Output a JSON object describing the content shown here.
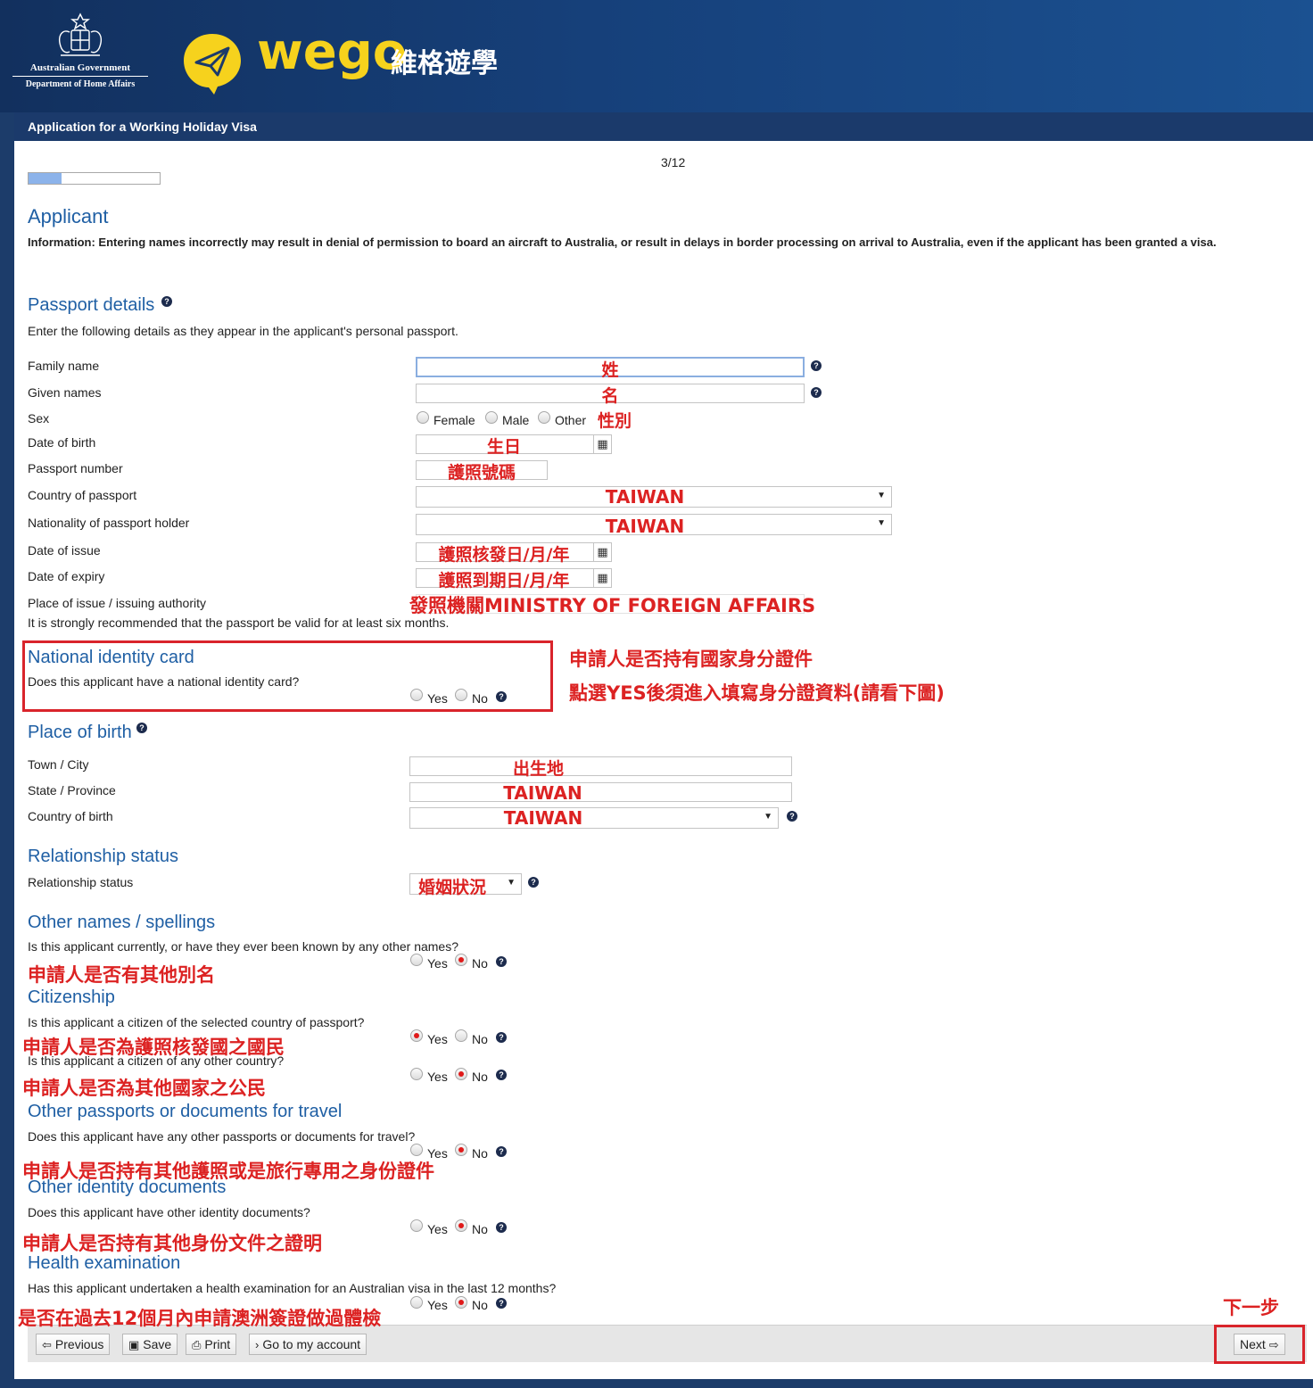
{
  "header": {
    "gov_line1": "Australian Government",
    "gov_line2": "Department of Home Affairs",
    "brand": "wego",
    "brand_cn": "維格遊學",
    "brand_color": "#f6d21d",
    "page_title": "Application for a Working Holiday Visa"
  },
  "progress": {
    "step": "3/12",
    "fraction": 0.25
  },
  "applicant": {
    "heading": "Applicant",
    "info": "Information: Entering names incorrectly may result in denial of permission to board an aircraft to Australia, or result in delays in border processing on arrival to Australia, even if the applicant has been granted a visa."
  },
  "passport": {
    "heading": "Passport details",
    "intro": "Enter the following details as they appear in the applicant's personal passport.",
    "family_name_label": "Family name",
    "family_name_value": "姓",
    "given_names_label": "Given names",
    "given_names_value": "名",
    "sex_label": "Sex",
    "sex_options": [
      "Female",
      "Male",
      "Other"
    ],
    "sex_note": "性別",
    "dob_label": "Date of birth",
    "dob_value": "生日",
    "passport_number_label": "Passport number",
    "passport_number_value": "護照號碼",
    "country_label": "Country of passport",
    "country_value": "TAIWAN",
    "nationality_label": "Nationality of passport holder",
    "nationality_value": "TAIWAN",
    "issue_label": "Date of issue",
    "issue_value": "護照核發日/月/年",
    "expiry_label": "Date of expiry",
    "expiry_value": "護照到期日/月/年",
    "place_label": "Place of issue / issuing authority",
    "place_value": "發照機關MINISTRY OF FOREIGN AFFAIRS",
    "validity_note": "It is strongly recommended that the passport be valid for at least six months."
  },
  "national_id": {
    "heading": "National identity card",
    "question": "Does this applicant have a national identity card?",
    "yes": "Yes",
    "no": "No",
    "note1": "申請人是否持有國家身分證件",
    "note2": "點選YES後須進入填寫身分證資料(請看下圖)"
  },
  "birth": {
    "heading": "Place of birth",
    "town_label": "Town / City",
    "town_value": "出生地",
    "state_label": "State / Province",
    "state_value": "TAIWAN",
    "country_label": "Country of birth",
    "country_value": "TAIWAN"
  },
  "relationship": {
    "heading": "Relationship status",
    "label": "Relationship status",
    "value": "婚姻狀況"
  },
  "other_names": {
    "heading": "Other names / spellings",
    "question": "Is this applicant currently, or have they ever been known by any other names?",
    "yes": "Yes",
    "no": "No",
    "note": "申請人是否有其他別名"
  },
  "citizenship": {
    "heading": "Citizenship",
    "q1": "Is this applicant a citizen of the selected country of passport?",
    "note1": "申請人是否為護照核發國之國民",
    "q2": "Is this applicant a citizen of any other country?",
    "note2": "申請人是否為其他國家之公民",
    "yes": "Yes",
    "no": "No"
  },
  "other_passports": {
    "heading": "Other passports or documents for travel",
    "question": "Does this applicant have any other passports or documents for travel?",
    "note": "申請人是否持有其他護照或是旅行專用之身份證件",
    "yes": "Yes",
    "no": "No"
  },
  "other_identity": {
    "heading": "Other identity documents",
    "question": "Does this applicant have other identity documents?",
    "note": "申請人是否持有其他身份文件之證明",
    "yes": "Yes",
    "no": "No"
  },
  "health": {
    "heading": "Health examination",
    "question": "Has this applicant undertaken a health examination for an Australian visa in the last 12 months?",
    "note": "是否在過去12個月內申請澳洲簽證做過體檢",
    "yes": "Yes",
    "no": "No"
  },
  "footer": {
    "previous": "Previous",
    "save": "Save",
    "print": "Print",
    "account": "Go to my account",
    "next": "Next",
    "next_note": "下一步"
  },
  "colors": {
    "accent_red": "#dc2222",
    "heading_blue": "#1f5fa4",
    "header_navy": "#1b3a6b"
  }
}
